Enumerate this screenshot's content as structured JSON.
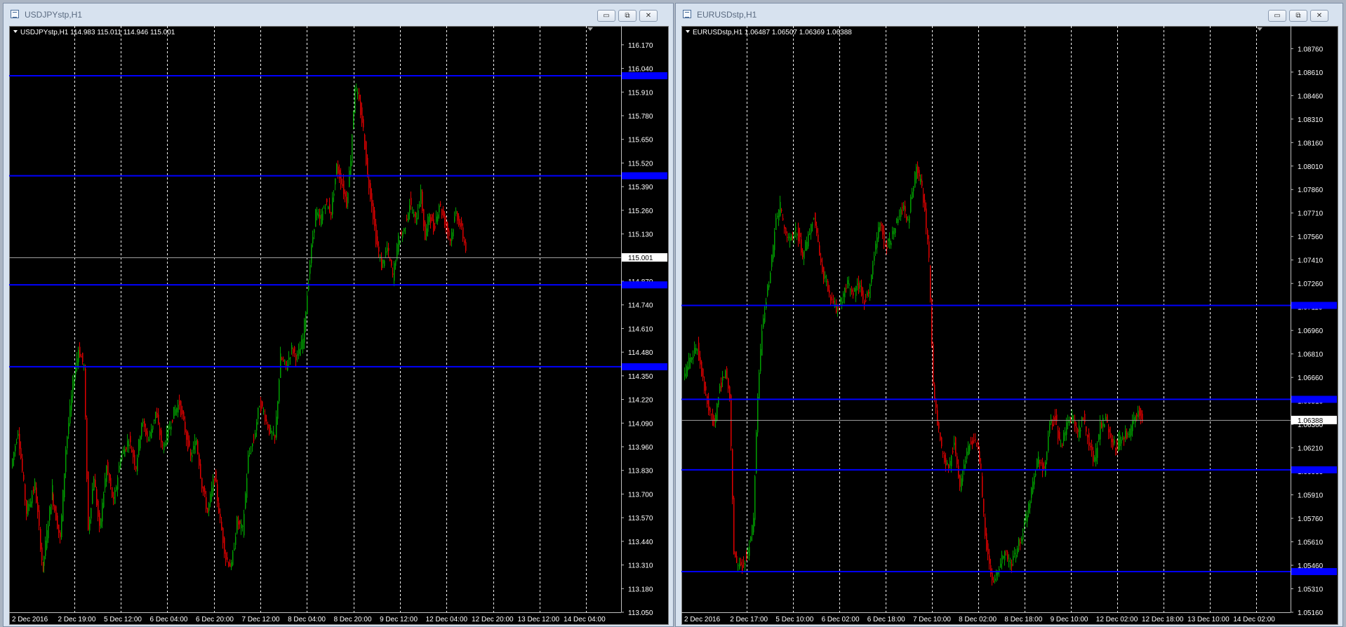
{
  "windows": [
    {
      "id": "usdjpy",
      "title": "USDJPYstp,H1",
      "info": "USDJPYstp,H1  114.983 115.011 114.946 115.001",
      "price_tag": "115.001",
      "buttons": {
        "minimize": "▭",
        "restore": "⧉",
        "close": "✕"
      }
    },
    {
      "id": "eurusd",
      "title": "EURUSDstp,H1",
      "info": "EURUSDstp,H1  1.06487 1.06507 1.06369 1.06388",
      "price_tag": "1.06388",
      "buttons": {
        "minimize": "▭",
        "restore": "⧉",
        "close": "✕"
      }
    }
  ],
  "chart_data": [
    {
      "type": "candlestick",
      "symbol": "USDJPYstp",
      "timeframe": "H1",
      "title": "USDJPYstp,H1",
      "ohlc_current": {
        "open": 114.983,
        "high": 115.011,
        "low": 114.946,
        "close": 115.001
      },
      "x_ticks": [
        "2 Dec 2016",
        "2 Dec 19:00",
        "5 Dec 12:00",
        "6 Dec 04:00",
        "6 Dec 20:00",
        "7 Dec 12:00",
        "8 Dec 04:00",
        "8 Dec 20:00",
        "9 Dec 12:00",
        "12 Dec 04:00",
        "12 Dec 20:00",
        "13 Dec 12:00",
        "14 Dec 04:00"
      ],
      "y_ticks": [
        "116.170",
        "116.040",
        "115.910",
        "115.780",
        "115.650",
        "115.520",
        "115.390",
        "115.260",
        "115.130",
        "115.000",
        "114.870",
        "114.740",
        "114.610",
        "114.480",
        "114.350",
        "114.220",
        "114.090",
        "113.960",
        "113.830",
        "113.700",
        "113.570",
        "113.440",
        "113.310",
        "113.180",
        "113.050"
      ],
      "ylim": [
        113.05,
        116.235
      ],
      "current_price": 115.001,
      "horizontal_lines": [
        116.0,
        115.45,
        114.85,
        114.4
      ],
      "vertical_grid": true,
      "grid": "vertical-dashed",
      "colors": {
        "bull": "#00a000",
        "bear": "#e00000",
        "hline": "#0000ff",
        "grid": "#ffffff",
        "background": "#000000"
      },
      "path_points": [
        [
          0,
          113.85
        ],
        [
          10,
          114.05
        ],
        [
          22,
          113.6
        ],
        [
          34,
          113.75
        ],
        [
          45,
          113.3
        ],
        [
          58,
          113.7
        ],
        [
          70,
          113.45
        ],
        [
          78,
          113.95
        ],
        [
          88,
          114.3
        ],
        [
          96,
          114.5
        ],
        [
          104,
          114.4
        ],
        [
          110,
          113.5
        ],
        [
          118,
          113.8
        ],
        [
          126,
          113.5
        ],
        [
          136,
          113.85
        ],
        [
          146,
          113.65
        ],
        [
          156,
          113.9
        ],
        [
          168,
          114.0
        ],
        [
          178,
          113.85
        ],
        [
          186,
          114.1
        ],
        [
          196,
          114.0
        ],
        [
          206,
          114.15
        ],
        [
          216,
          113.95
        ],
        [
          224,
          114.05
        ],
        [
          232,
          114.15
        ],
        [
          240,
          114.2
        ],
        [
          248,
          114.05
        ],
        [
          256,
          113.9
        ],
        [
          264,
          114.0
        ],
        [
          272,
          113.75
        ],
        [
          280,
          113.6
        ],
        [
          290,
          113.8
        ],
        [
          298,
          113.55
        ],
        [
          306,
          113.35
        ],
        [
          314,
          113.3
        ],
        [
          322,
          113.55
        ],
        [
          330,
          113.5
        ],
        [
          338,
          113.9
        ],
        [
          346,
          114.0
        ],
        [
          354,
          114.2
        ],
        [
          360,
          114.15
        ],
        [
          368,
          114.05
        ],
        [
          376,
          114.0
        ],
        [
          384,
          114.45
        ],
        [
          392,
          114.4
        ],
        [
          400,
          114.5
        ],
        [
          408,
          114.45
        ],
        [
          416,
          114.55
        ],
        [
          422,
          114.8
        ],
        [
          428,
          115.05
        ],
        [
          434,
          115.25
        ],
        [
          440,
          115.2
        ],
        [
          448,
          115.3
        ],
        [
          456,
          115.25
        ],
        [
          464,
          115.5
        ],
        [
          472,
          115.4
        ],
        [
          478,
          115.3
        ],
        [
          484,
          115.55
        ],
        [
          490,
          115.95
        ],
        [
          496,
          115.85
        ],
        [
          502,
          115.7
        ],
        [
          508,
          115.45
        ],
        [
          514,
          115.3
        ],
        [
          520,
          115.1
        ],
        [
          528,
          114.95
        ],
        [
          536,
          115.05
        ],
        [
          544,
          114.9
        ],
        [
          552,
          115.1
        ],
        [
          560,
          115.15
        ],
        [
          568,
          115.3
        ],
        [
          576,
          115.2
        ],
        [
          584,
          115.35
        ],
        [
          590,
          115.1
        ],
        [
          596,
          115.25
        ],
        [
          602,
          115.15
        ],
        [
          610,
          115.3
        ],
        [
          618,
          115.2
        ],
        [
          626,
          115.1
        ],
        [
          634,
          115.25
        ],
        [
          642,
          115.15
        ],
        [
          648,
          115.05
        ]
      ]
    },
    {
      "type": "candlestick",
      "symbol": "EURUSDstp",
      "timeframe": "H1",
      "title": "EURUSDstp,H1",
      "ohlc_current": {
        "open": 1.06487,
        "high": 1.06507,
        "low": 1.06369,
        "close": 1.06388
      },
      "x_ticks": [
        "2 Dec 2016",
        "2 Dec 17:00",
        "5 Dec 10:00",
        "6 Dec 02:00",
        "6 Dec 18:00",
        "7 Dec 10:00",
        "8 Dec 02:00",
        "8 Dec 18:00",
        "9 Dec 10:00",
        "12 Dec 02:00",
        "12 Dec 18:00",
        "13 Dec 10:00",
        "14 Dec 02:00"
      ],
      "y_ticks": [
        "1.08760",
        "1.08610",
        "1.08460",
        "1.08310",
        "1.08160",
        "1.08010",
        "1.07860",
        "1.07710",
        "1.07560",
        "1.07410",
        "1.07260",
        "1.07110",
        "1.06960",
        "1.06810",
        "1.06660",
        "1.06510",
        "1.06360",
        "1.06210",
        "1.06060",
        "1.05910",
        "1.05760",
        "1.05610",
        "1.05460",
        "1.05310",
        "1.05160"
      ],
      "ylim": [
        1.0516,
        1.0886
      ],
      "current_price": 1.06388,
      "horizontal_lines": [
        1.0712,
        1.0652,
        1.0607,
        1.0542
      ],
      "vertical_grid": true,
      "grid": "vertical-dashed",
      "colors": {
        "bull": "#00a000",
        "bear": "#e00000",
        "hline": "#0000ff",
        "grid": "#ffffff",
        "background": "#000000"
      },
      "path_points": [
        [
          0,
          1.0665
        ],
        [
          10,
          1.068
        ],
        [
          20,
          1.0685
        ],
        [
          28,
          1.0665
        ],
        [
          36,
          1.0645
        ],
        [
          44,
          1.0635
        ],
        [
          52,
          1.066
        ],
        [
          60,
          1.067
        ],
        [
          66,
          1.0655
        ],
        [
          72,
          1.0555
        ],
        [
          78,
          1.0545
        ],
        [
          84,
          1.0545
        ],
        [
          92,
          1.0555
        ],
        [
          100,
          1.0575
        ],
        [
          106,
          1.0655
        ],
        [
          112,
          1.0695
        ],
        [
          118,
          1.0715
        ],
        [
          124,
          1.0735
        ],
        [
          132,
          1.0765
        ],
        [
          138,
          1.0775
        ],
        [
          146,
          1.0755
        ],
        [
          154,
          1.0755
        ],
        [
          162,
          1.076
        ],
        [
          170,
          1.0745
        ],
        [
          178,
          1.0755
        ],
        [
          186,
          1.077
        ],
        [
          192,
          1.075
        ],
        [
          198,
          1.0735
        ],
        [
          204,
          1.0725
        ],
        [
          210,
          1.0715
        ],
        [
          218,
          1.071
        ],
        [
          226,
          1.0715
        ],
        [
          234,
          1.0725
        ],
        [
          242,
          1.072
        ],
        [
          250,
          1.0725
        ],
        [
          258,
          1.0715
        ],
        [
          264,
          1.072
        ],
        [
          272,
          1.0745
        ],
        [
          280,
          1.0765
        ],
        [
          288,
          1.075
        ],
        [
          296,
          1.0755
        ],
        [
          304,
          1.0765
        ],
        [
          312,
          1.0775
        ],
        [
          320,
          1.0765
        ],
        [
          326,
          1.0785
        ],
        [
          332,
          1.08
        ],
        [
          338,
          1.079
        ],
        [
          344,
          1.0775
        ],
        [
          350,
          1.074
        ],
        [
          356,
          1.066
        ],
        [
          362,
          1.0635
        ],
        [
          370,
          1.0615
        ],
        [
          378,
          1.0608
        ],
        [
          386,
          1.0625
        ],
        [
          394,
          1.0595
        ],
        [
          402,
          1.0615
        ],
        [
          410,
          1.0625
        ],
        [
          418,
          1.0625
        ],
        [
          424,
          1.0605
        ],
        [
          430,
          1.0565
        ],
        [
          436,
          1.0545
        ],
        [
          442,
          1.0535
        ],
        [
          450,
          1.0545
        ],
        [
          458,
          1.0555
        ],
        [
          466,
          1.0545
        ],
        [
          474,
          1.0555
        ],
        [
          482,
          1.0565
        ],
        [
          490,
          1.058
        ],
        [
          498,
          1.06
        ],
        [
          506,
          1.0615
        ],
        [
          514,
          1.0605
        ],
        [
          522,
          1.0635
        ],
        [
          530,
          1.064
        ],
        [
          538,
          1.062
        ],
        [
          546,
          1.0635
        ],
        [
          554,
          1.064
        ],
        [
          562,
          1.063
        ],
        [
          570,
          1.064
        ],
        [
          578,
          1.0625
        ],
        [
          586,
          1.0612
        ],
        [
          594,
          1.0635
        ],
        [
          602,
          1.064
        ],
        [
          610,
          1.0625
        ],
        [
          618,
          1.0622
        ],
        [
          626,
          1.063
        ],
        [
          634,
          1.0628
        ],
        [
          642,
          1.0638
        ],
        [
          648,
          1.0645
        ],
        [
          654,
          1.0639
        ]
      ]
    }
  ]
}
